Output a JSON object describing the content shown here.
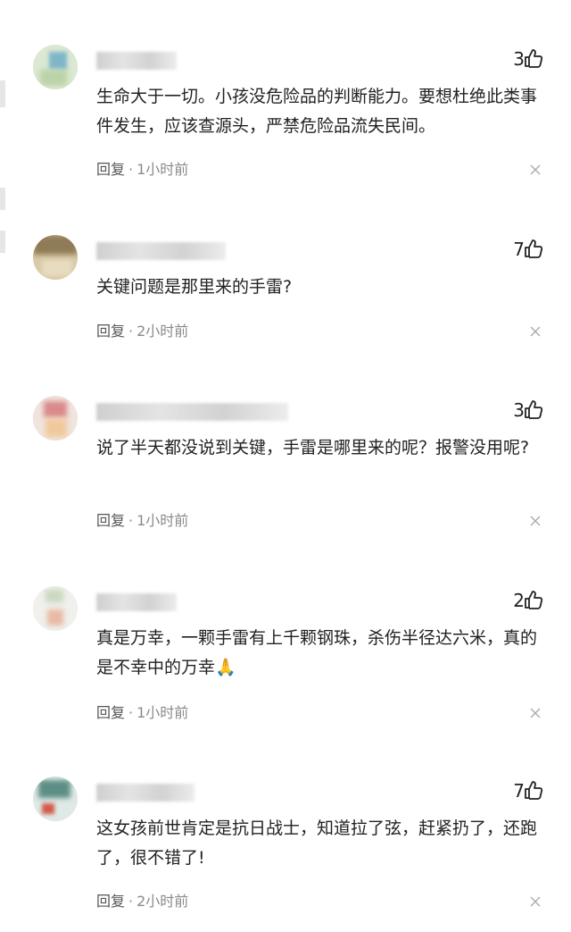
{
  "comments": [
    {
      "likes": "3",
      "text": "生命大于一切。小孩没危险品的判断能力。要想杜绝此类事件发生，应该查源头，严禁危险品流失民间。",
      "reply_label": "回复",
      "dot": "·",
      "time": "1小时前"
    },
    {
      "likes": "7",
      "text": "关键问题是那里来的手雷?",
      "reply_label": "回复",
      "dot": "·",
      "time": "2小时前"
    },
    {
      "likes": "3",
      "text": "说了半天都没说到关键，手雷是哪里来的呢？报警没用呢?",
      "reply_label": "回复",
      "dot": "·",
      "time": "1小时前"
    },
    {
      "likes": "2",
      "text": "真是万幸，一颗手雷有上千颗钢珠，杀伤半径达六米，真的是不幸中的万幸🙏",
      "reply_label": "回复",
      "dot": "·",
      "time": "1小时前"
    },
    {
      "likes": "7",
      "text": "这女孩前世肯定是抗日战士，知道拉了弦，赶紧扔了，还跑了，很不错了!",
      "reply_label": "回复",
      "dot": "·",
      "time": "2小时前"
    }
  ],
  "icons": {
    "like": "thumbs-up-icon",
    "close": "close-icon",
    "avatar": "avatar"
  },
  "colors": {
    "text": "#222222",
    "meta": "#8a8a8a",
    "blur": "#d6d6d6"
  }
}
